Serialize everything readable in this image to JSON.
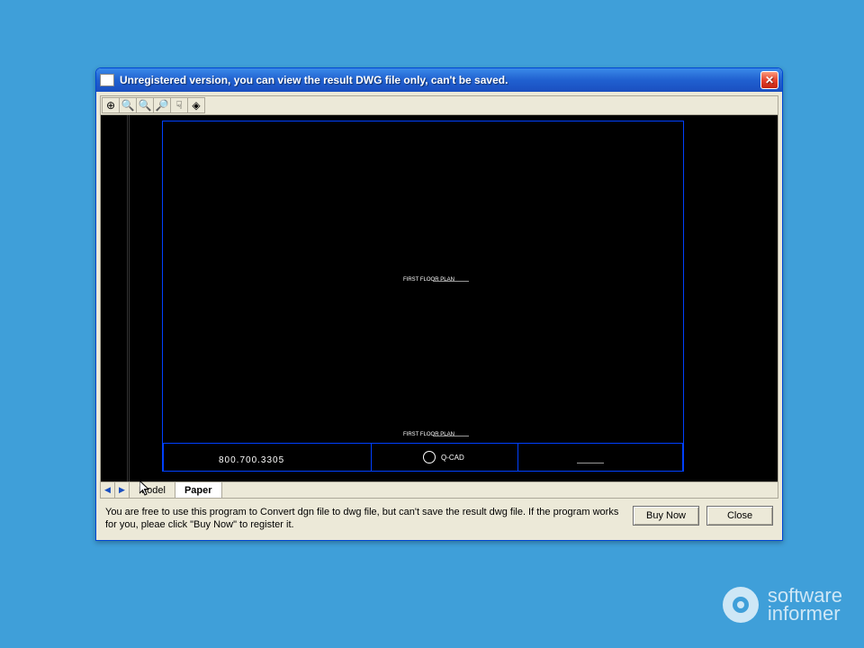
{
  "window": {
    "title": "Unregistered version, you can view the result DWG file only, can't be saved."
  },
  "toolbar": {
    "zoom_extents": "⊕",
    "zoom_window": "🔍",
    "zoom_in": "🔍⁺",
    "zoom_out": "🔍⁻",
    "pan": "✋",
    "rotate": "◈"
  },
  "canvas": {
    "phone": "800.700.3305",
    "brand": "Q-CAD",
    "mark1": "FIRST FLOOR PLAN",
    "mark2": "FIRST FLOOR PLAN"
  },
  "tabs": {
    "prev": "◀",
    "next": "▶",
    "model": "Model",
    "paper": "Paper"
  },
  "footer": {
    "info": "You are free to use this program to Convert dgn file to dwg file, but can't save the result dwg file. If the program works for you, pleae click \"Buy Now\" to register it.",
    "buy": "Buy Now",
    "close": "Close"
  },
  "watermark": {
    "line1": "software",
    "line2": "informer"
  }
}
